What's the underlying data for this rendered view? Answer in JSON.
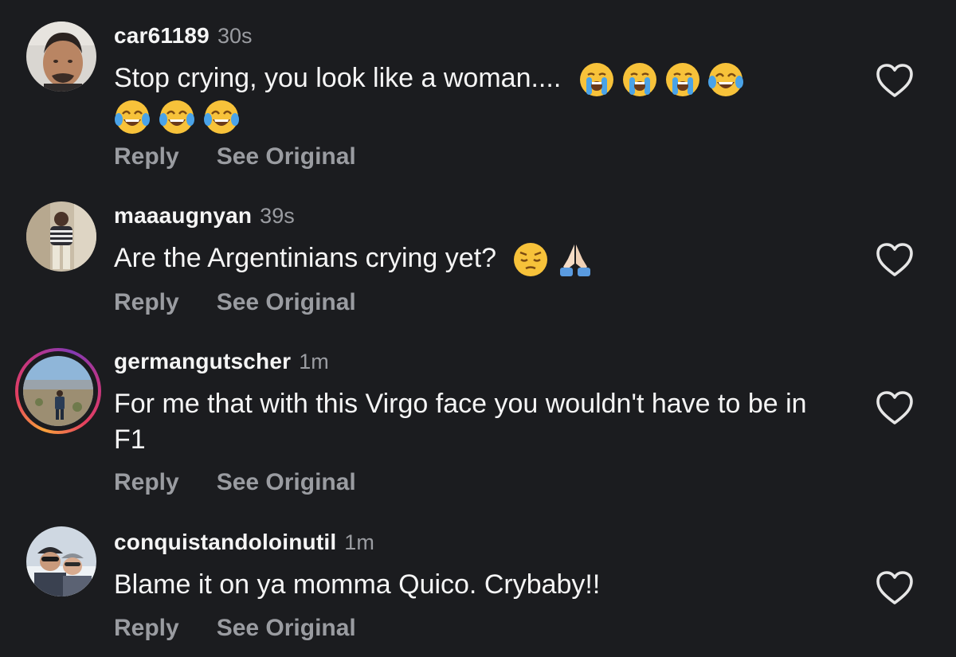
{
  "comments": [
    {
      "username": "car61189",
      "time": "30s",
      "text": "Stop crying, you look like a woman....",
      "emojis": [
        "loudly-crying-face",
        "loudly-crying-face",
        "loudly-crying-face",
        "face-with-tears-of-joy",
        "face-with-tears-of-joy",
        "face-with-tears-of-joy",
        "face-with-tears-of-joy"
      ],
      "reply_label": "Reply",
      "see_original_label": "See Original"
    },
    {
      "username": "maaaugnyan",
      "time": "39s",
      "text": "Are the Argentinians crying yet?",
      "emojis": [
        "pensive-face",
        "folded-hands"
      ],
      "reply_label": "Reply",
      "see_original_label": "See Original"
    },
    {
      "username": "germangutscher",
      "time": "1m",
      "text": "For me that with this Virgo face you wouldn't have to be in F1",
      "emojis": [],
      "has_story_ring": true,
      "reply_label": "Reply",
      "see_original_label": "See Original"
    },
    {
      "username": "conquistandoloinutil",
      "time": "1m",
      "text": "Blame it on ya momma Quico. Crybaby!!",
      "emojis": [],
      "reply_label": "Reply",
      "see_original_label": "See Original"
    }
  ],
  "colors": {
    "background": "#1b1c1f",
    "primary_text": "#f5f5f5",
    "secondary_text": "#9a9ca1",
    "heart_outline": "#e6e6e6"
  },
  "icons": {
    "like": "heart-outline-icon"
  }
}
